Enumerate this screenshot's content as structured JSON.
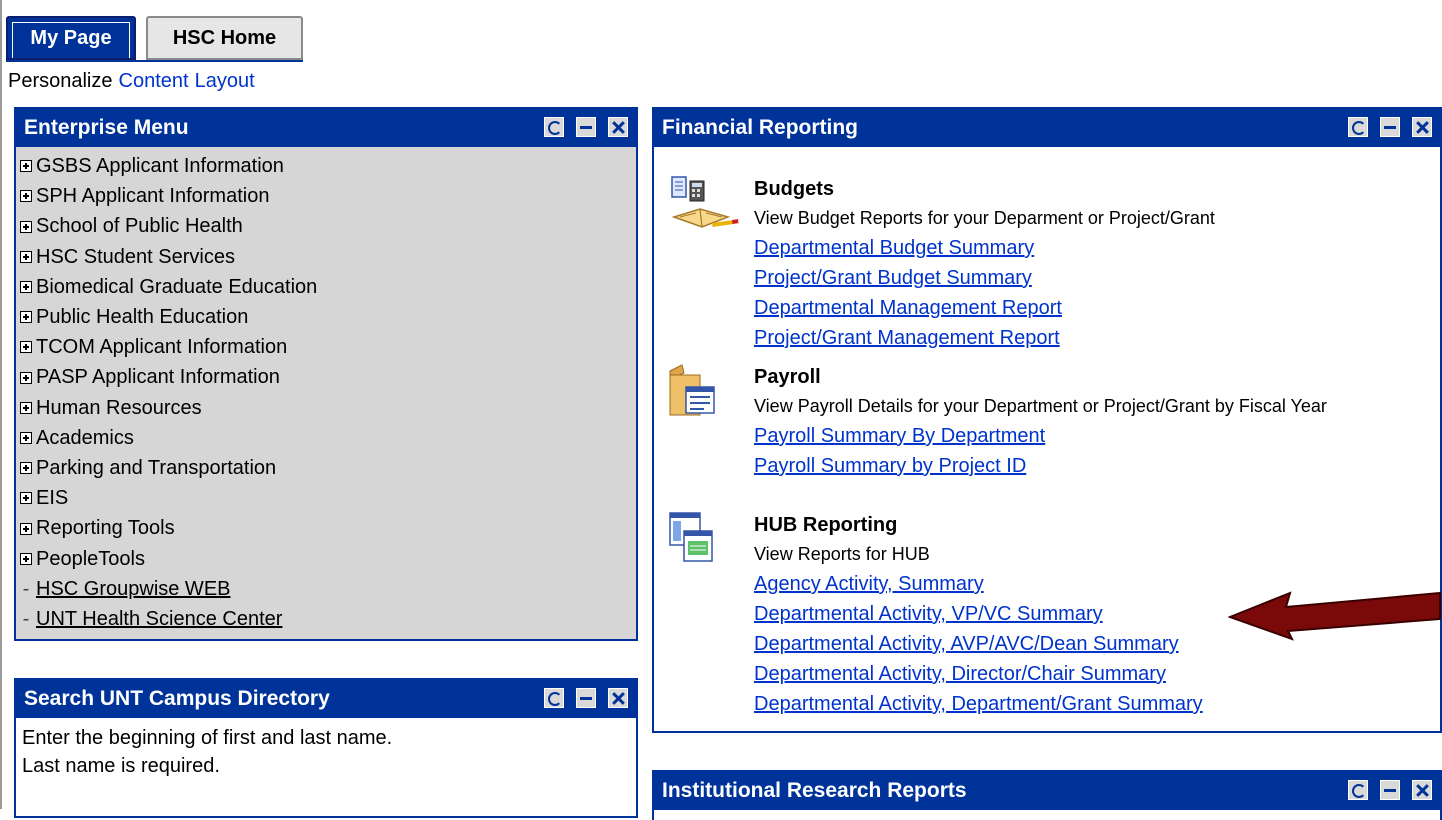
{
  "tabs": [
    {
      "label": "My Page",
      "active": true
    },
    {
      "label": "HSC Home",
      "active": false
    }
  ],
  "personalize": {
    "label": "Personalize",
    "links": [
      "Content",
      "Layout"
    ]
  },
  "enterprise_menu": {
    "title": "Enterprise Menu",
    "folders": [
      "GSBS Applicant Information",
      "SPH Applicant Information",
      "School of Public Health",
      "HSC Student Services",
      "Biomedical Graduate Education",
      "Public Health Education",
      "TCOM Applicant Information",
      "PASP Applicant Information",
      "Human Resources",
      "Academics",
      "Parking and Transportation",
      "EIS",
      "Reporting Tools",
      "PeopleTools"
    ],
    "links": [
      "HSC Groupwise WEB",
      "UNT Health Science Center"
    ]
  },
  "search_directory": {
    "title": "Search UNT Campus Directory",
    "line1": "Enter the beginning of first and last name.",
    "line2": "Last name is required."
  },
  "financial_reporting": {
    "title": "Financial Reporting",
    "budgets": {
      "heading": "Budgets",
      "description": "View Budget Reports for your Deparment or Project/Grant",
      "links": [
        "Departmental Budget Summary",
        "Project/Grant Budget Summary",
        "Departmental Management Report",
        "Project/Grant Management Report"
      ]
    },
    "payroll": {
      "heading": "Payroll",
      "description": "View Payroll Details for your Department or Project/Grant by Fiscal Year",
      "links": [
        "Payroll Summary By Department",
        "Payroll Summary by Project ID"
      ]
    },
    "hub": {
      "heading": "HUB Reporting",
      "description": "View Reports for HUB",
      "links": [
        "Agency Activity, Summary",
        "Departmental Activity, VP/VC Summary",
        "Departmental Activity, AVP/AVC/Dean Summary",
        "Departmental Activity, Director/Chair Summary",
        "Departmental Activity, Department/Grant Summary"
      ]
    }
  },
  "institutional_research": {
    "title": "Institutional Research Reports"
  },
  "colors": {
    "header_blue": "#003399",
    "link_blue": "#0033cc",
    "menu_gray": "#d6d6d6",
    "arrow": "#7a0a0a"
  }
}
